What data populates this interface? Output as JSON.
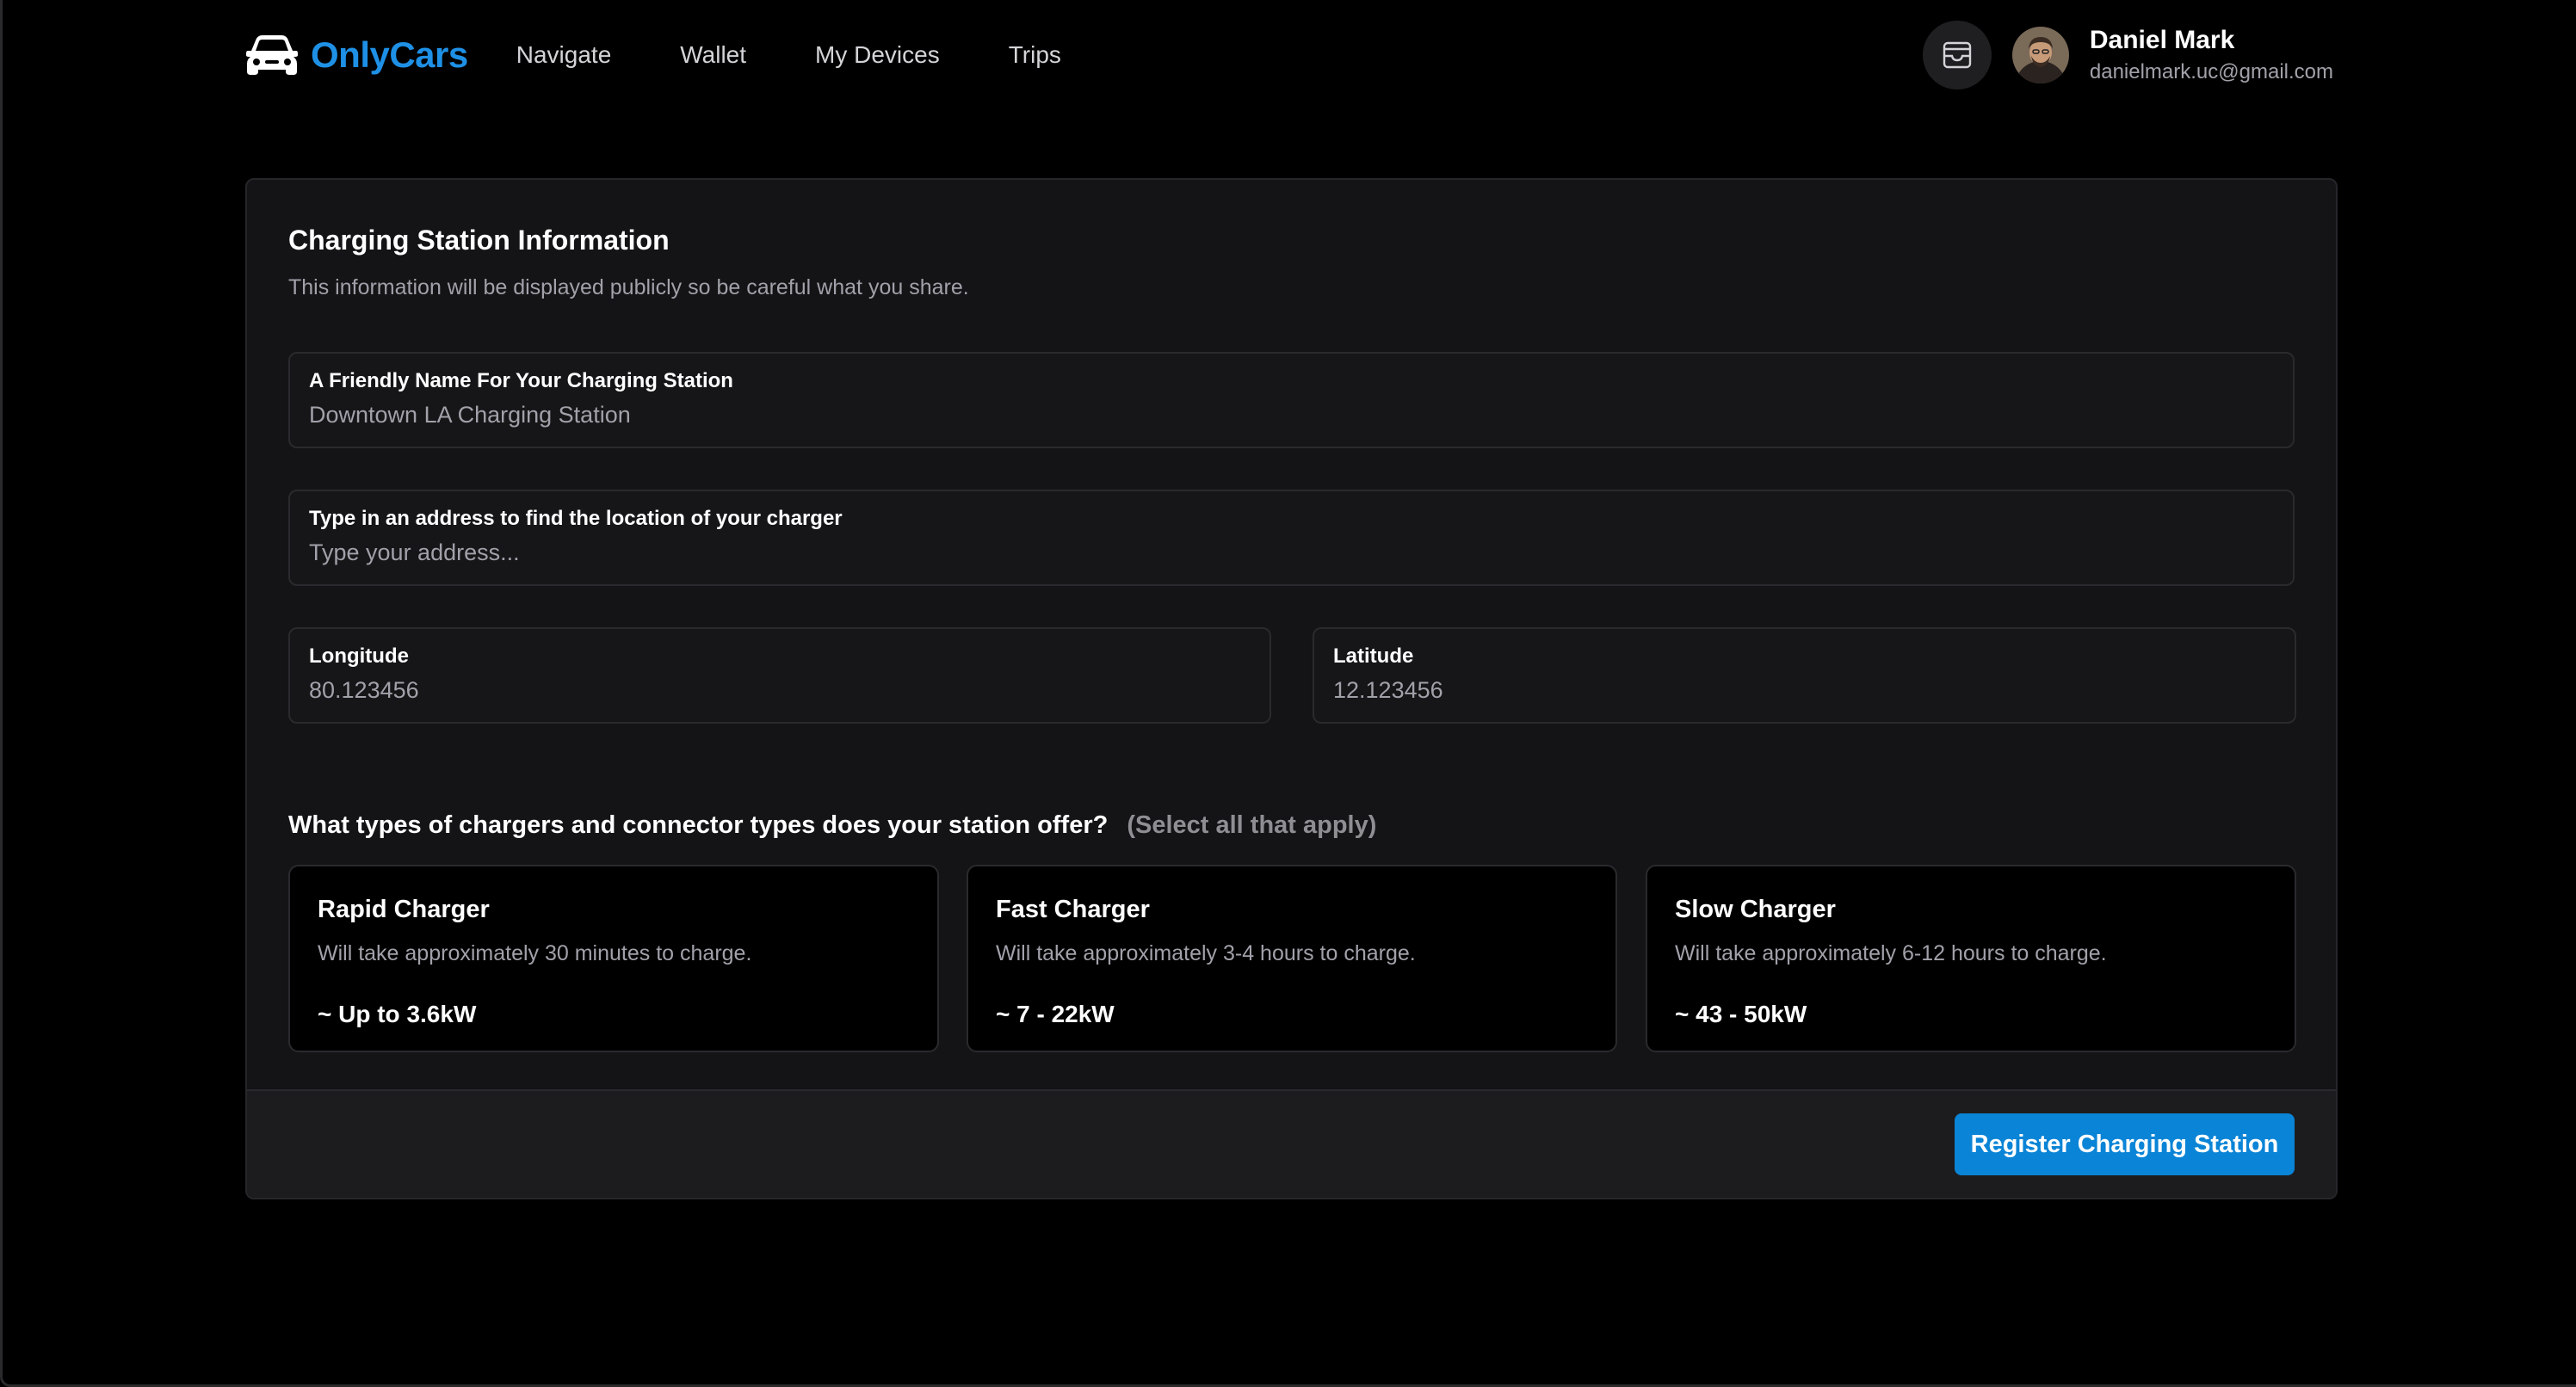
{
  "brand": {
    "name": "OnlyCars",
    "color": "#1e90e6",
    "icon": "car-icon"
  },
  "nav": {
    "links": [
      {
        "label": "Navigate"
      },
      {
        "label": "Wallet"
      },
      {
        "label": "My Devices"
      },
      {
        "label": "Trips"
      }
    ]
  },
  "user": {
    "inbox_icon": "inbox-icon",
    "name": "Daniel Mark",
    "email": "danielmark.uc@gmail.com"
  },
  "form": {
    "title": "Charging Station Information",
    "description": "This information will be displayed publicly so be careful what you share.",
    "name_field": {
      "label": "A Friendly Name For Your Charging Station",
      "value": "Downtown LA Charging Station"
    },
    "address_field": {
      "label": "Type in an address to find the location of your charger",
      "value": "",
      "placeholder": "Type your address..."
    },
    "longitude_field": {
      "label": "Longitude",
      "value": "",
      "placeholder": "80.123456"
    },
    "latitude_field": {
      "label": "Latitude",
      "value": "",
      "placeholder": "12.123456"
    },
    "charger_question": "What types of chargers and connector types does your station offer?",
    "charger_hint": "(Select all that apply)",
    "chargers": [
      {
        "name": "Rapid Charger",
        "description": "Will take approximately 30 minutes to charge.",
        "power": "~ Up to 3.6kW"
      },
      {
        "name": "Fast Charger",
        "description": "Will take approximately 3-4 hours to charge.",
        "power": "~ 7 - 22kW"
      },
      {
        "name": "Slow Charger",
        "description": "Will take approximately 6-12 hours to charge.",
        "power": "~ 43 - 50kW"
      }
    ],
    "submit_label": "Register Charging Station",
    "submit_color": "#0a84d6"
  }
}
